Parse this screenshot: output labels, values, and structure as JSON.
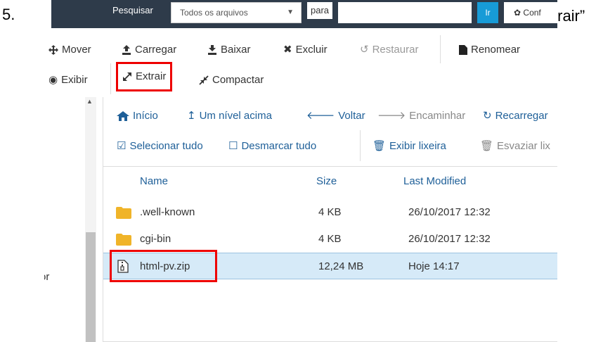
{
  "caption": {
    "step": "5.",
    "tail": "trair”"
  },
  "topbar": {
    "search_label": "Pesquisar",
    "scope_value": "Todos os arquivos",
    "connector": "para",
    "query_value": "",
    "go_label": "Ir",
    "config_label": "Conf"
  },
  "toolbar": {
    "row1": {
      "move": "Mover",
      "upload": "Carregar",
      "download": "Baixar",
      "delete": "Excluir",
      "restore": "Restaurar",
      "rename": "Renomear"
    },
    "row2": {
      "view": "Exibir",
      "extract": "Extrair",
      "compress": "Compactar"
    }
  },
  "nav": {
    "home": "Início",
    "up": "Um nível acima",
    "back": "Voltar",
    "forward": "Encaminhar",
    "reload": "Recarregar",
    "select_all": "Selecionar tudo",
    "deselect_all": "Desmarcar tudo",
    "show_trash": "Exibir lixeira",
    "empty_trash": "Esvaziar lix"
  },
  "sidebar": {
    "partial_text": "or"
  },
  "listing": {
    "headers": {
      "name": "Name",
      "size": "Size",
      "modified": "Last Modified"
    },
    "rows": [
      {
        "name": ".well-known",
        "size": "4 KB",
        "modified": "26/10/2017 12:32",
        "type": "folder"
      },
      {
        "name": "cgi-bin",
        "size": "4 KB",
        "modified": "26/10/2017 12:32",
        "type": "folder"
      },
      {
        "name": "html-pv.zip",
        "size": "12,24 MB",
        "modified": "Hoje 14:17",
        "type": "zip",
        "selected": true
      }
    ]
  },
  "colors": {
    "topbar": "#2e3b4a",
    "accent": "#179bd7",
    "link": "#1e5f98",
    "highlight": "#e00000",
    "folder": "#f0b429",
    "selected_row": "#d6eaf8"
  }
}
